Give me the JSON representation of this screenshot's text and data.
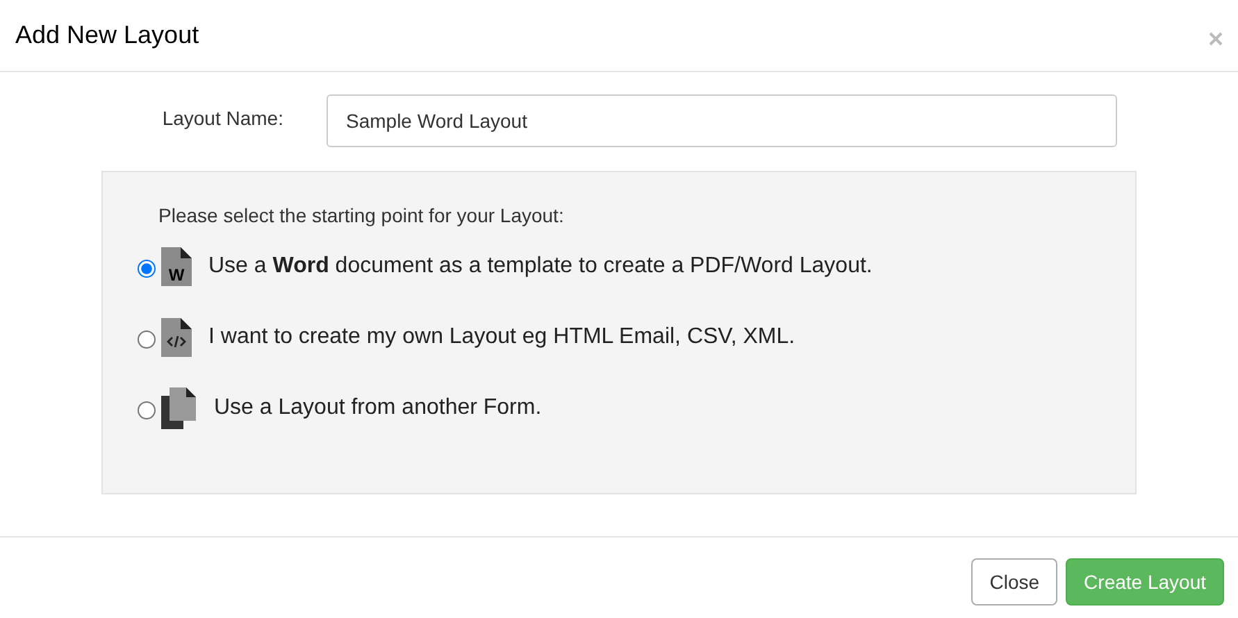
{
  "dialog": {
    "title": "Add New Layout"
  },
  "layout_name": {
    "label": "Layout Name:",
    "value": "Sample Word Layout"
  },
  "panel": {
    "prompt": "Please select the starting point for your Layout:",
    "options": [
      {
        "kind": "word",
        "icon_text": "W",
        "text": "Use a **Word** document as a template to create a PDF/Word Layout.",
        "selected": true
      },
      {
        "kind": "code",
        "text": "I want to create my own Layout eg HTML Email, CSV, XML.",
        "selected": false
      },
      {
        "kind": "copy",
        "text": "Use a Layout from another Form.",
        "selected": false
      }
    ]
  },
  "buttons": [
    {
      "kind": "default",
      "label": "Close"
    },
    {
      "kind": "primary",
      "label": "Create Layout"
    }
  ]
}
